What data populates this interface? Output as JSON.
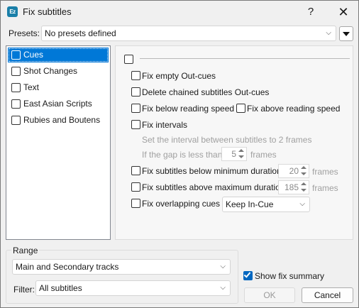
{
  "window": {
    "title": "Fix subtitles",
    "icon_text": "Ez",
    "help_label": "?",
    "close_label": "✕"
  },
  "presets": {
    "label": "Presets:",
    "selected": "No presets defined",
    "menu_icon": "triangle-down-icon"
  },
  "categories": [
    {
      "label": "Cues",
      "selected": true,
      "checked": false
    },
    {
      "label": "Shot Changes",
      "selected": false,
      "checked": false
    },
    {
      "label": "Text",
      "selected": false,
      "checked": false
    },
    {
      "label": "East Asian Scripts",
      "selected": false,
      "checked": false
    },
    {
      "label": "Rubies and Boutens",
      "selected": false,
      "checked": false
    }
  ],
  "cues": {
    "fix_empty_out": "Fix empty Out-cues",
    "delete_chained": "Delete chained subtitles Out-cues",
    "fix_below_speed": "Fix below reading speed",
    "fix_above_speed": "Fix above reading speed",
    "fix_intervals": "Fix intervals",
    "interval_text": "Set the interval between subtitles to 2 frames",
    "gap_label": "If the gap is less than",
    "gap_value": "5",
    "gap_unit": "frames",
    "below_min": "Fix subtitles below minimum duration",
    "min_value": "20",
    "min_unit": "frames",
    "above_max": "Fix subtitles above maximum duration",
    "max_value": "185",
    "max_unit": "frames",
    "fix_overlapping": "Fix overlapping cues",
    "overlap_mode": "Keep In-Cue"
  },
  "range": {
    "label": "Range",
    "tracks": "Main and Secondary tracks",
    "filter_label": "Filter:",
    "filter_value": "All subtitles"
  },
  "summary": {
    "label": "Show fix summary",
    "checked": true
  },
  "buttons": {
    "ok": "OK",
    "cancel": "Cancel"
  },
  "colors": {
    "accent": "#0078d7",
    "checkbox_checked": "#0067c0",
    "app_icon": "#1a7fa8"
  }
}
